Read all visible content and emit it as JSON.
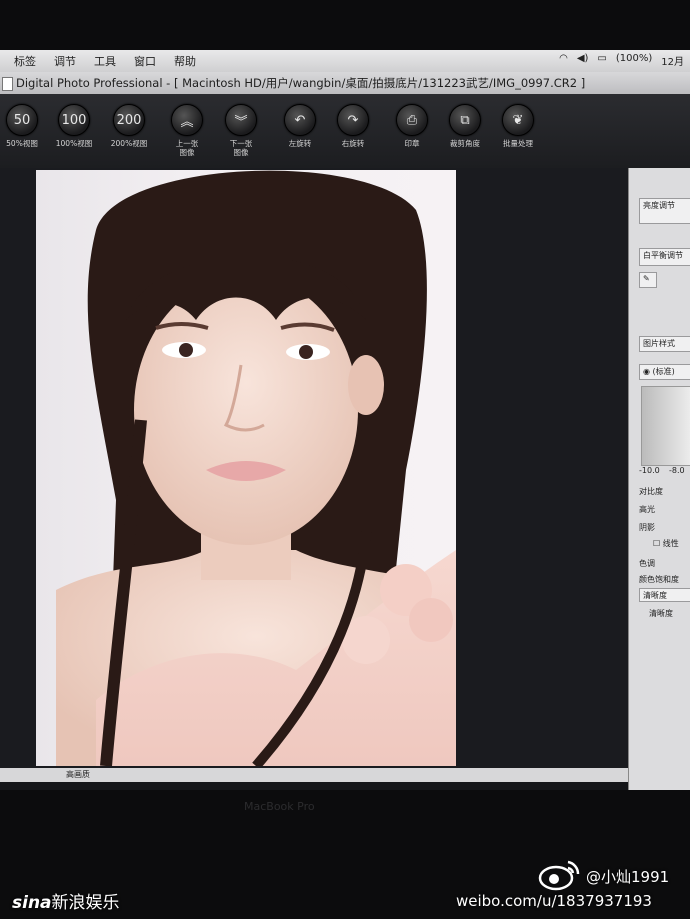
{
  "menubar": {
    "menus": [
      "标签",
      "调节",
      "工具",
      "窗口",
      "帮助"
    ],
    "battery": "(100%)",
    "time": "12月"
  },
  "window": {
    "title": "Digital Photo Professional - [ Macintosh HD/用户/wangbin/桌面/拍摄底片/131223武艺/IMG_0997.CR2 ]"
  },
  "toolbar": {
    "tools": [
      {
        "glyph": "50",
        "label": "50%视图",
        "icon": "zoom-50-icon"
      },
      {
        "glyph": "100",
        "label": "100%视图",
        "icon": "zoom-100-icon"
      },
      {
        "glyph": "200",
        "label": "200%视图",
        "icon": "zoom-200-icon"
      },
      {
        "glyph": "︽",
        "label": "上一张\n图像",
        "icon": "prev-image-icon"
      },
      {
        "glyph": "︾",
        "label": "下一张\n图像",
        "icon": "next-image-icon"
      },
      {
        "glyph": "↶",
        "label": "左旋转",
        "icon": "rotate-left-icon"
      },
      {
        "glyph": "↷",
        "label": "右旋转",
        "icon": "rotate-right-icon"
      },
      {
        "glyph": "⎙",
        "label": "印章",
        "icon": "stamp-icon"
      },
      {
        "glyph": "⧉",
        "label": "裁剪角度",
        "icon": "crop-icon"
      },
      {
        "glyph": "❦",
        "label": "批量处理",
        "icon": "batch-process-icon"
      }
    ]
  },
  "panel": {
    "brightness": "亮度调节",
    "white_balance": "白平衡调节",
    "picture_style": "图片样式",
    "style_value": "(标准)",
    "scale_min": "-10.0",
    "scale_mid": "-8.0",
    "contrast": "对比度",
    "highlight": "高光",
    "shadow": "阴影",
    "linear": "线性",
    "tone": "色调",
    "saturation": "颜色饱和度",
    "sharpness_select": "清晰度",
    "sharpness": "清晰度"
  },
  "statusbar": {
    "quality": "高画质"
  },
  "bezel": {
    "label": "MacBook Pro"
  },
  "watermark": {
    "brand": "sina",
    "brand_cn": "新浪娱乐",
    "handle": "@小灿1991",
    "url": "weibo.com/u/1837937193"
  }
}
